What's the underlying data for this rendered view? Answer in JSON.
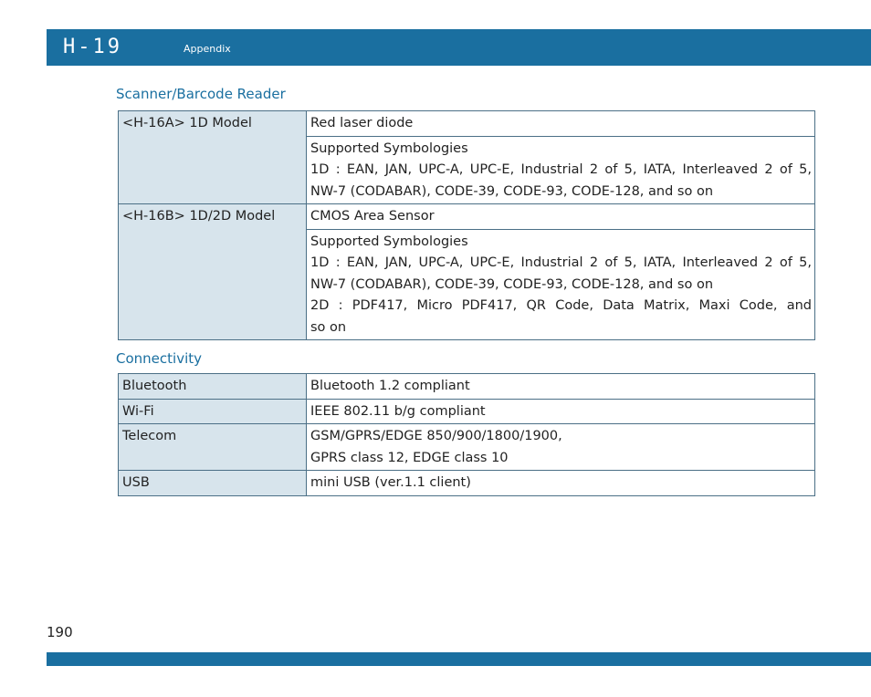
{
  "header": {
    "chapter_code": "H-19",
    "chapter_title": "Appendix"
  },
  "scanner": {
    "heading": "Scanner/Barcode Reader",
    "h16a_label": "<H-16A> 1D Model",
    "h16a_sensor": "Red laser diode",
    "h16a_symbologies": [
      "Supported Symbologies",
      "1D : EAN, JAN, UPC-A, UPC-E, Industrial 2 of 5, IATA, Interleaved 2 of 5,",
      "NW-7 (CODABAR), CODE-39, CODE-93, CODE-128, and so on"
    ],
    "h16b_label": "<H-16B> 1D/2D Model",
    "h16b_sensor": "CMOS Area Sensor",
    "h16b_symbologies": [
      "Supported Symbologies",
      "1D : EAN, JAN, UPC-A, UPC-E, Industrial 2 of 5, IATA, Interleaved 2 of 5,",
      "NW-7 (CODABAR), CODE-39, CODE-93, CODE-128, and so on",
      "2D : PDF417, Micro PDF417, QR Code, Data Matrix, Maxi Code, and",
      "so on"
    ]
  },
  "connectivity": {
    "heading": "Connectivity",
    "rows": [
      {
        "label": "Bluetooth",
        "value": [
          "Bluetooth 1.2 compliant"
        ]
      },
      {
        "label": "Wi-Fi",
        "value": [
          "IEEE 802.11 b/g compliant"
        ]
      },
      {
        "label": "Telecom",
        "value": [
          "GSM/GPRS/EDGE 850/900/1800/1900,",
          "GPRS class 12, EDGE class 10"
        ]
      },
      {
        "label": "USB",
        "value": [
          "mini USB (ver.1.1 client)"
        ]
      }
    ]
  },
  "footer": {
    "page_number": "190"
  }
}
